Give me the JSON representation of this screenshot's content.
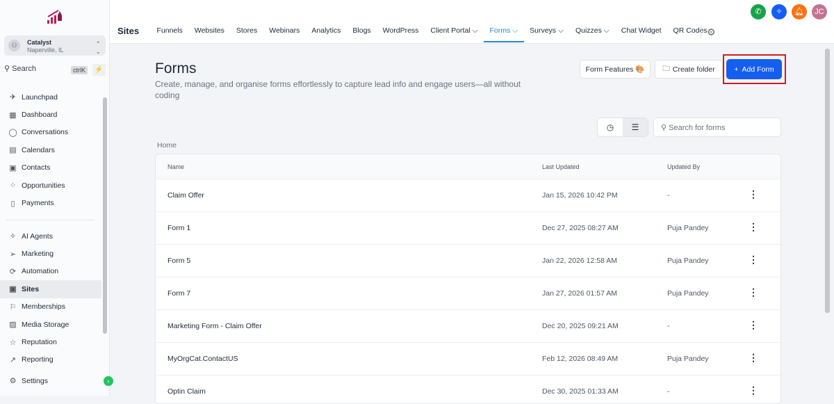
{
  "sidebar": {
    "account": {
      "name": "Catalyst",
      "location": "Naperville, IL"
    },
    "search": {
      "label": "Search",
      "shortcut": "ctrlK"
    },
    "items": [
      {
        "icon": "rocket-icon",
        "label": "Launchpad"
      },
      {
        "icon": "grid-icon",
        "label": "Dashboard"
      },
      {
        "icon": "chat-icon",
        "label": "Conversations"
      },
      {
        "icon": "calendar-icon",
        "label": "Calendars"
      },
      {
        "icon": "contacts-icon",
        "label": "Contacts"
      },
      {
        "icon": "opportunities-icon",
        "label": "Opportunities"
      },
      {
        "icon": "payments-icon",
        "label": "Payments"
      }
    ],
    "items2": [
      {
        "icon": "sparkle-icon",
        "label": "AI Agents"
      },
      {
        "icon": "send-icon",
        "label": "Marketing"
      },
      {
        "icon": "automation-icon",
        "label": "Automation"
      },
      {
        "icon": "sites-icon",
        "label": "Sites"
      },
      {
        "icon": "membership-icon",
        "label": "Memberships"
      },
      {
        "icon": "image-icon",
        "label": "Media Storage"
      },
      {
        "icon": "star-icon",
        "label": "Reputation"
      },
      {
        "icon": "chart-icon",
        "label": "Reporting"
      }
    ],
    "settings": "Settings"
  },
  "topbar": {
    "title": "Sites",
    "tabs": [
      "Funnels",
      "Websites",
      "Stores",
      "Webinars",
      "Analytics",
      "Blogs",
      "WordPress",
      "Client Portal ⌵",
      "Forms ⌵",
      "Surveys ⌵",
      "Quizzes ⌵",
      "Chat Widget",
      "QR Codes"
    ],
    "active": "Forms",
    "avatar": "JC"
  },
  "page": {
    "title": "Forms",
    "subtitle": "Create, manage, and organise forms effortlessly to capture lead info and engage users—all without coding",
    "form_features": "Form Features 🎨",
    "create_folder": "Create folder",
    "add_form": "Add Form",
    "search_placeholder": "Search for forms",
    "breadcrumb": "Home"
  },
  "table": {
    "headers": [
      "Name",
      "Last Updated",
      "Updated By"
    ],
    "rows": [
      [
        "Claim Offer",
        "Jan 15, 2026 10:42 PM",
        "-"
      ],
      [
        "Form 1",
        "Dec 27, 2025 08:27 AM",
        "Puja Pandey"
      ],
      [
        "Form 5",
        "Jan 22, 2026 12:58 AM",
        "Puja Pandey"
      ],
      [
        "Form 7",
        "Jan 27, 2026 01:57 AM",
        "Puja Pandey"
      ],
      [
        "Marketing Form - Claim Offer",
        "Dec 20, 2025 09:21 AM",
        "-"
      ],
      [
        "MyOrgCat.ContactUS",
        "Feb 12, 2026 08:49 AM",
        "Puja Pandey"
      ],
      [
        "Optin Claim",
        "Dec 30, 2025 01:33 AM",
        "-"
      ]
    ]
  }
}
